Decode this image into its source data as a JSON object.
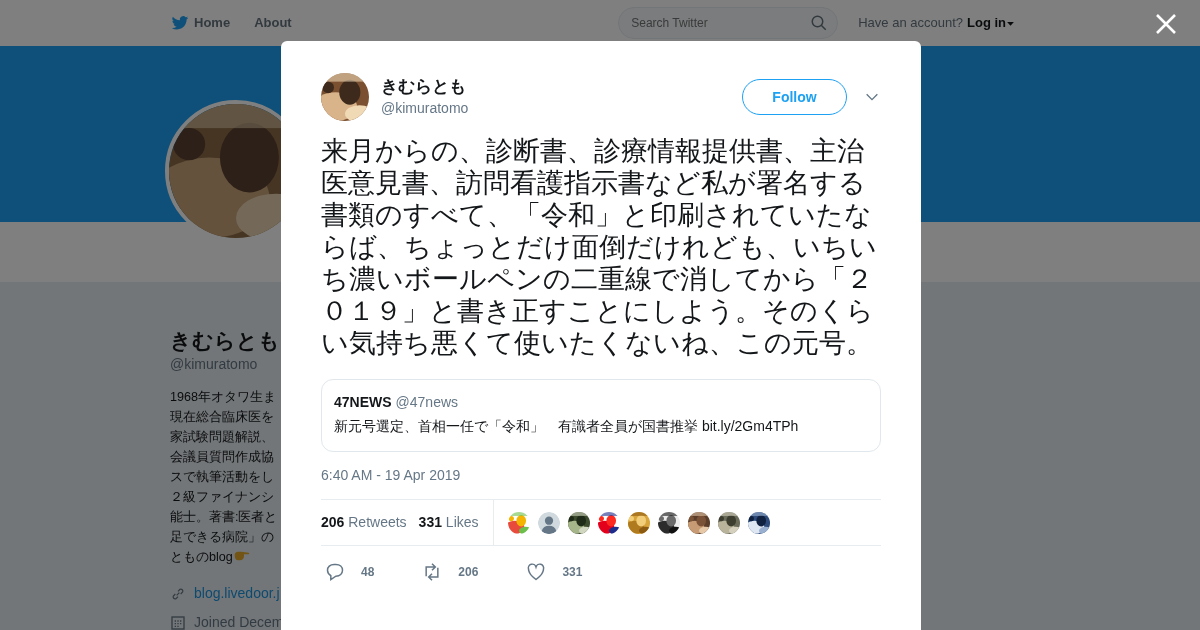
{
  "top_nav": {
    "links": [
      {
        "label": "Home",
        "kind": "home"
      },
      {
        "label": "About",
        "kind": "plain"
      }
    ],
    "search": {
      "placeholder": "Search Twitter"
    },
    "account_prompt": "Have an account?",
    "login": "Log in"
  },
  "profile": {
    "name": "きむらとも",
    "handle": "@kimuratomo",
    "bio_lines": [
      "1968年オタワ生ま",
      "現在総合臨床医を",
      "家試験問題解説、",
      "会議員質問作成協",
      "スで執筆活動をし",
      "２級ファイナンシ",
      "能士。著書:医者と",
      "足できる病院」の"
    ],
    "bio_last": "とものblog",
    "link": "blog.livedoor.j",
    "joined": "Joined Decem"
  },
  "tweet": {
    "name": "きむらとも",
    "handle": "@kimuratomo",
    "follow_label": "Follow",
    "text": "来月からの、診断書、診療情報提供書、主治医意見書、訪問看護指示書など私が署名する書類のすべて、「令和」と印刷されていたならば、ちょっとだけ面倒だけれども、いちいち濃いボールペンの二重線で消してから「２０１９」と書き正すことにしよう。そのくらい気持ち悪くて使いたくないね、この元号。",
    "quote": {
      "name": "47NEWS",
      "handle": "@47news",
      "text": "新元号選定、首相一任で「令和」　有識者全員が国書推挙 bit.ly/2Gm4TPh"
    },
    "time": "6:40 AM - 19 Apr 2019",
    "stats": [
      {
        "count": "206",
        "label": "Retweets"
      },
      {
        "count": "331",
        "label": "Likes"
      }
    ],
    "likers": [
      {
        "kind": "picture"
      },
      {
        "kind": "default"
      },
      {
        "kind": "picture"
      },
      {
        "kind": "picture"
      },
      {
        "kind": "picture"
      },
      {
        "kind": "picture"
      },
      {
        "kind": "picture"
      },
      {
        "kind": "picture"
      },
      {
        "kind": "picture"
      }
    ],
    "actions": [
      {
        "kind": "reply",
        "count": "48"
      },
      {
        "kind": "retweet",
        "count": "206"
      },
      {
        "kind": "like",
        "count": "331"
      }
    ]
  }
}
